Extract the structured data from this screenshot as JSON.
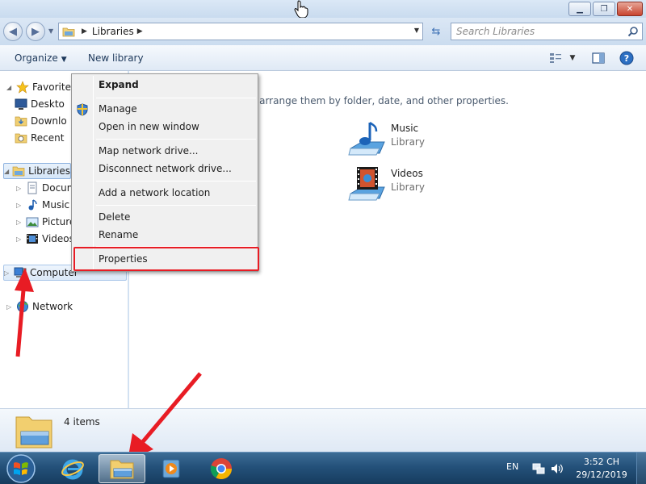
{
  "window": {
    "controls": {
      "minimize": "▁",
      "maximize": "❐",
      "close": "✕"
    }
  },
  "address": {
    "breadcrumb": [
      "Libraries"
    ],
    "search_placeholder": "Search Libraries"
  },
  "toolbar": {
    "organize": "Organize",
    "new_library": "New library"
  },
  "nav": {
    "favorites": "Favorites",
    "desktop": "Deskto",
    "downloads": "Downlo",
    "recent": "Recent",
    "libraries": "Libraries",
    "documents": "Docum",
    "music": "Music",
    "pictures": "Picture",
    "videos": "Videos",
    "computer": "Computer",
    "network": "Network"
  },
  "content": {
    "subtitle": "iles and arrange them by folder, date, and other properties.",
    "libraries": [
      {
        "name": "Music",
        "type": "Library"
      },
      {
        "name": "Videos",
        "type": "Library"
      }
    ]
  },
  "context_menu": {
    "items": [
      "Expand",
      "Manage",
      "Open in new window",
      "Map network drive...",
      "Disconnect network drive...",
      "Add a network location",
      "Delete",
      "Rename",
      "Properties"
    ]
  },
  "details": {
    "count": "4 items"
  },
  "taskbar": {
    "language": "EN",
    "time": "3:52 CH",
    "date": "29/12/2019"
  },
  "colors": {
    "annotation_red": "#e81c24",
    "taskbar": "#24517a",
    "selection": "#d5e6f8"
  }
}
